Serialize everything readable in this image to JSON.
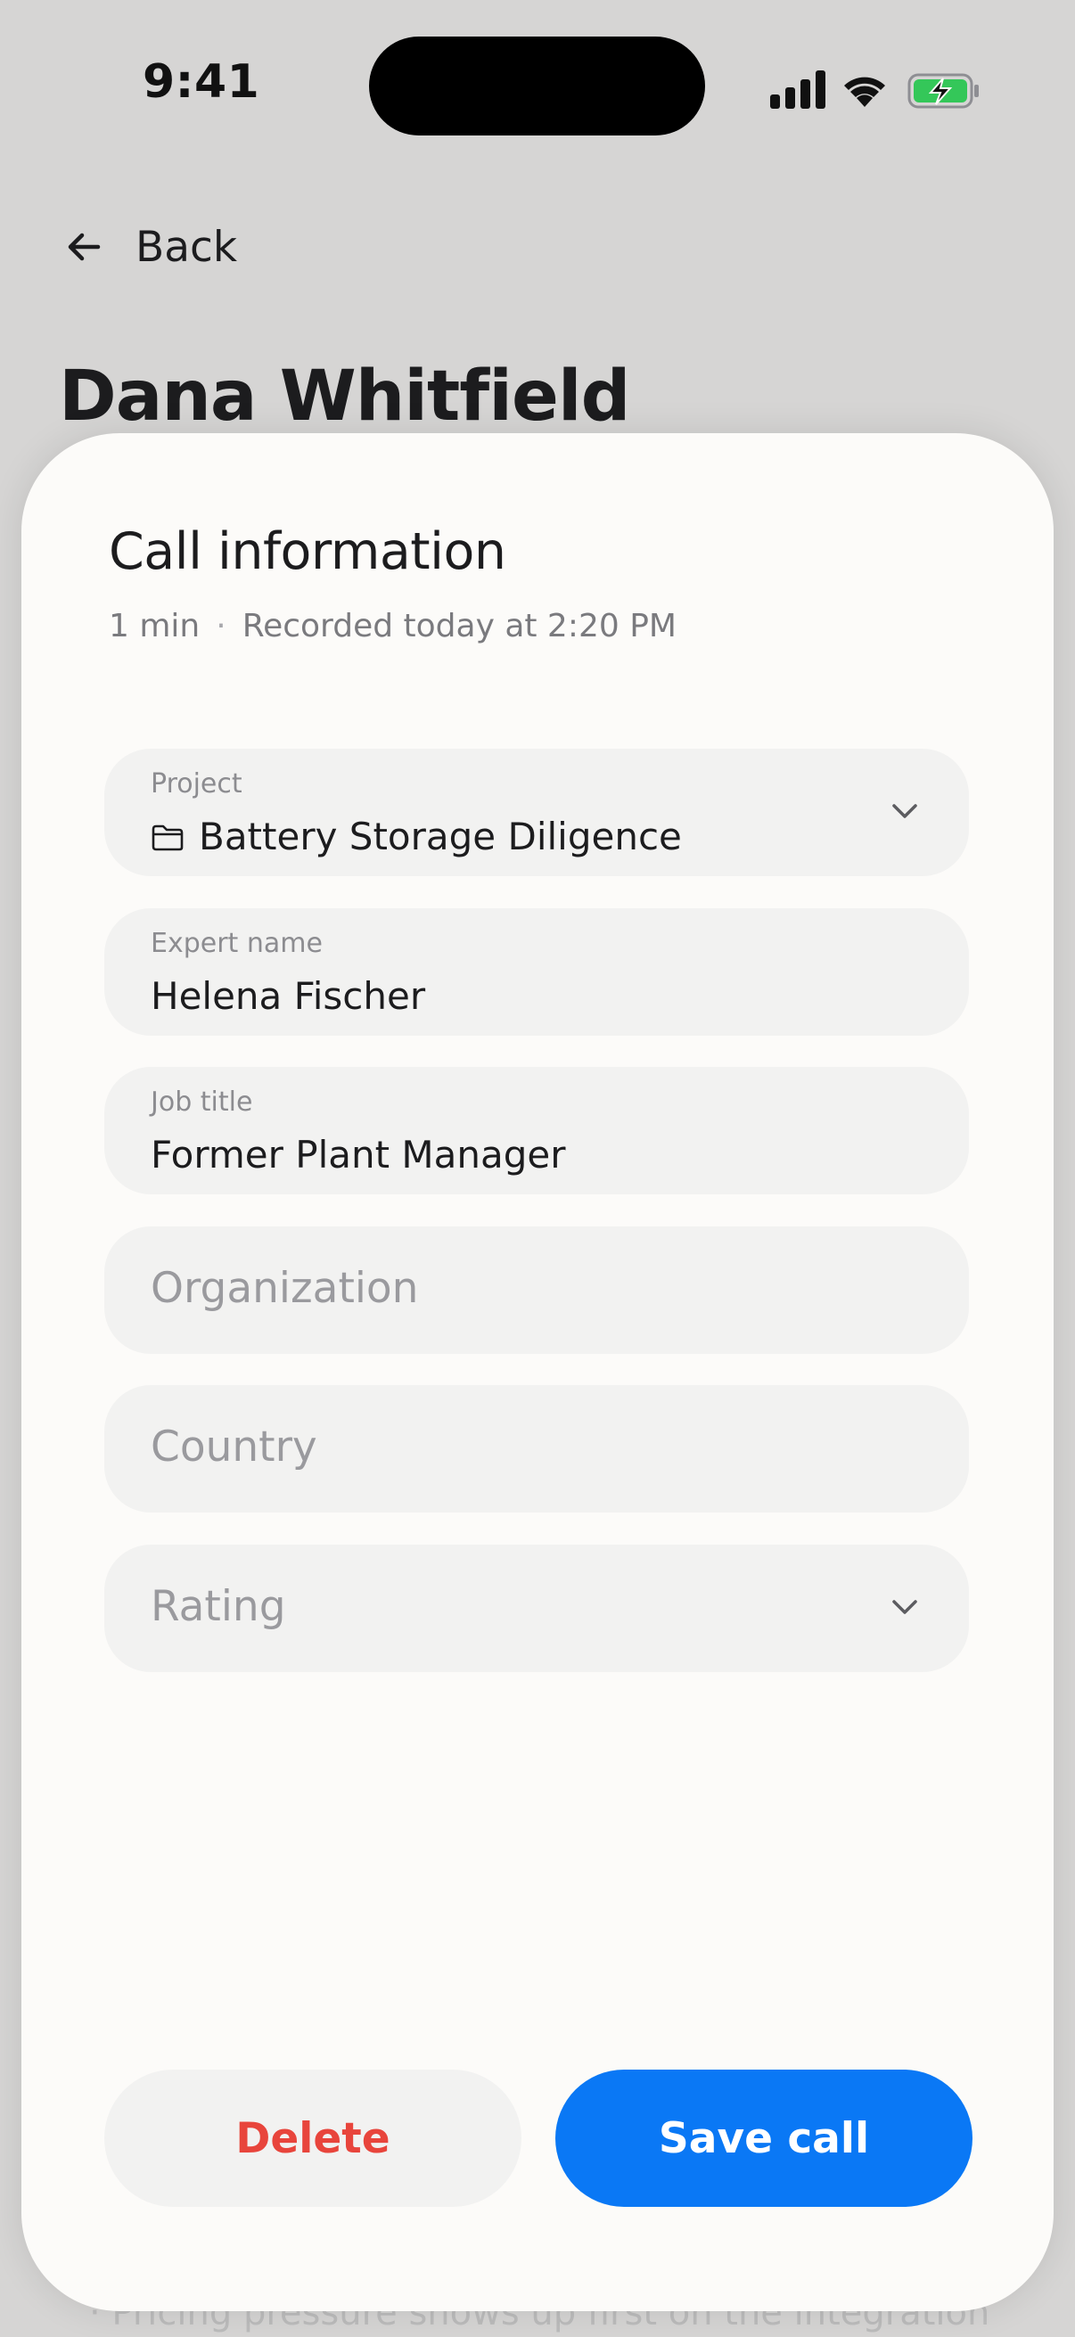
{
  "status_bar": {
    "time": "9:41",
    "icons": [
      "signal-icon",
      "wifi-icon",
      "battery-charging-icon"
    ],
    "battery_color": "#34c759"
  },
  "header": {
    "back_label": "Back",
    "person_name": "Dana Whitfield"
  },
  "sheet": {
    "title": "Call information",
    "duration": "1 min",
    "separator": "·",
    "recorded": "Recorded today at 2:20 PM",
    "fields": {
      "project": {
        "label": "Project",
        "value": "Battery Storage Diligence",
        "icon": "folder-icon"
      },
      "expert_name": {
        "label": "Expert name",
        "value": "Helena Fischer"
      },
      "job_title": {
        "label": "Job title",
        "value": "Former Plant Manager"
      },
      "organization": {
        "placeholder": "Organization"
      },
      "country": {
        "placeholder": "Country"
      },
      "rating": {
        "placeholder": "Rating"
      }
    },
    "actions": {
      "delete_label": "Delete",
      "save_label": "Save call"
    }
  },
  "background_text": {
    "bullet": "·   Pricing pressure shows up first on the integration"
  },
  "colors": {
    "accent": "#0a78f5",
    "destructive": "#e8453c",
    "backdrop": "#d6d5d4",
    "sheet": "#fcfbf9",
    "field": "#f2f2f1"
  }
}
